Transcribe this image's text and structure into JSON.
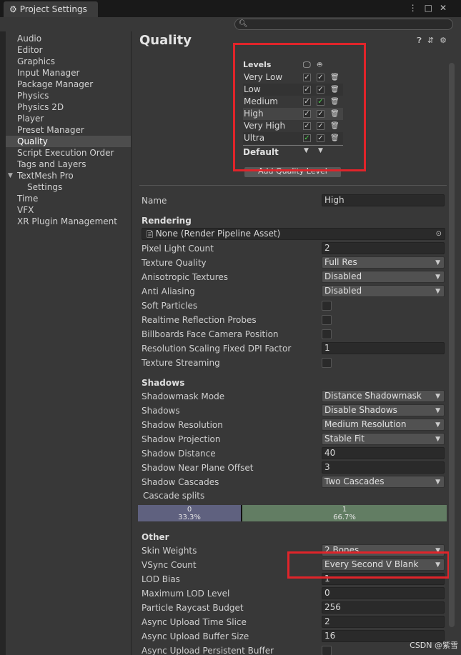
{
  "window": {
    "tab_title": "Project Settings",
    "tab_icon": "gear-icon"
  },
  "search": {
    "placeholder": "",
    "icon": "search-icon"
  },
  "sidebar": {
    "items": [
      {
        "label": "Audio"
      },
      {
        "label": "Editor"
      },
      {
        "label": "Graphics"
      },
      {
        "label": "Input Manager"
      },
      {
        "label": "Package Manager"
      },
      {
        "label": "Physics"
      },
      {
        "label": "Physics 2D"
      },
      {
        "label": "Player"
      },
      {
        "label": "Preset Manager"
      },
      {
        "label": "Quality",
        "selected": true
      },
      {
        "label": "Script Execution Order"
      },
      {
        "label": "Tags and Layers"
      },
      {
        "label": "TextMesh Pro",
        "expanded": true
      },
      {
        "label": "Settings",
        "child": true
      },
      {
        "label": "Time"
      },
      {
        "label": "VFX"
      },
      {
        "label": "XR Plugin Management"
      }
    ]
  },
  "main": {
    "title": "Quality",
    "levels_header": "Levels",
    "levels": [
      {
        "name": "Very Low",
        "standalone": true,
        "android": true
      },
      {
        "name": "Low",
        "standalone": true,
        "android": true
      },
      {
        "name": "Medium",
        "standalone": true,
        "android": true,
        "android_default": true
      },
      {
        "name": "High",
        "standalone": true,
        "android": true,
        "selected": true
      },
      {
        "name": "Very High",
        "standalone": true,
        "android": true
      },
      {
        "name": "Ultra",
        "standalone": true,
        "android": true,
        "standalone_default": true
      }
    ],
    "default_label": "Default",
    "add_button": "Add Quality Level",
    "name_label": "Name",
    "name_value": "High",
    "rendering": {
      "header": "Rendering",
      "render_pipeline": "None (Render Pipeline Asset)",
      "pixel_light_count_label": "Pixel Light Count",
      "pixel_light_count": "2",
      "texture_quality_label": "Texture Quality",
      "texture_quality": "Full Res",
      "anisotropic_label": "Anisotropic Textures",
      "anisotropic": "Disabled",
      "anti_aliasing_label": "Anti Aliasing",
      "anti_aliasing": "Disabled",
      "soft_particles_label": "Soft Particles",
      "realtime_reflection_label": "Realtime Reflection Probes",
      "billboards_label": "Billboards Face Camera Position",
      "resolution_scaling_label": "Resolution Scaling Fixed DPI Factor",
      "resolution_scaling": "1",
      "texture_streaming_label": "Texture Streaming"
    },
    "shadows": {
      "header": "Shadows",
      "shadowmask_label": "Shadowmask Mode",
      "shadowmask": "Distance Shadowmask",
      "shadows_label": "Shadows",
      "shadows": "Disable Shadows",
      "resolution_label": "Shadow Resolution",
      "resolution": "Medium Resolution",
      "projection_label": "Shadow Projection",
      "projection": "Stable Fit",
      "distance_label": "Shadow Distance",
      "distance": "40",
      "near_plane_label": "Shadow Near Plane Offset",
      "near_plane": "3",
      "cascades_label": "Shadow Cascades",
      "cascades": "Two Cascades",
      "cascade_splits_label": "Cascade splits",
      "split0_index": "0",
      "split0_pct": "33.3%",
      "split0_fraction": 0.333,
      "split1_index": "1",
      "split1_pct": "66.7%"
    },
    "other": {
      "header": "Other",
      "skin_weights_label": "Skin Weights",
      "skin_weights": "2 Bones",
      "vsync_label": "VSync Count",
      "vsync": "Every Second V Blank",
      "lod_bias_label": "LOD Bias",
      "lod_bias": "1",
      "max_lod_label": "Maximum LOD Level",
      "max_lod": "0",
      "particle_raycast_label": "Particle Raycast Budget",
      "particle_raycast": "256",
      "async_time_label": "Async Upload Time Slice",
      "async_time": "2",
      "async_buffer_label": "Async Upload Buffer Size",
      "async_buffer": "16",
      "async_persistent_label": "Async Upload Persistent Buffer"
    }
  },
  "watermark": "CSDN @紫雪",
  "colors": {
    "highlight_box": "#e0242a",
    "checkmark_green": "#4fd04f"
  }
}
